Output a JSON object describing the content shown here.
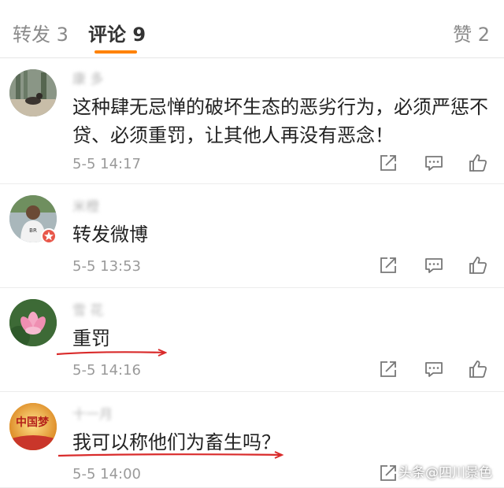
{
  "tabs": [
    {
      "label": "转发 3"
    },
    {
      "label": "评论 9"
    },
    {
      "label": "赞 2"
    }
  ],
  "comments": [
    {
      "username": "康      多",
      "text": "这种肆无忌惮的破坏生态的恶劣行为，必须严惩不贷、必须重罚，让其他人再没有恶念！",
      "time": "5-5 14:17"
    },
    {
      "username": "米橙",
      "text": "转发微博",
      "time": "5-5 13:53"
    },
    {
      "username": "雪      花",
      "text": "重罚",
      "time": "5-5 14:16"
    },
    {
      "username": "十一月",
      "text": "我可以称他们为畜生吗？",
      "time": "5-5 14:00"
    }
  ],
  "avatar4_text": "中国梦",
  "watermark": "头条@四川景色",
  "colors": {
    "accent": "#ff8200",
    "annotation": "#d92b2b",
    "text": "#222222",
    "muted": "#9a9a9a"
  },
  "icons": [
    "share-icon",
    "comment-icon",
    "like-icon"
  ]
}
